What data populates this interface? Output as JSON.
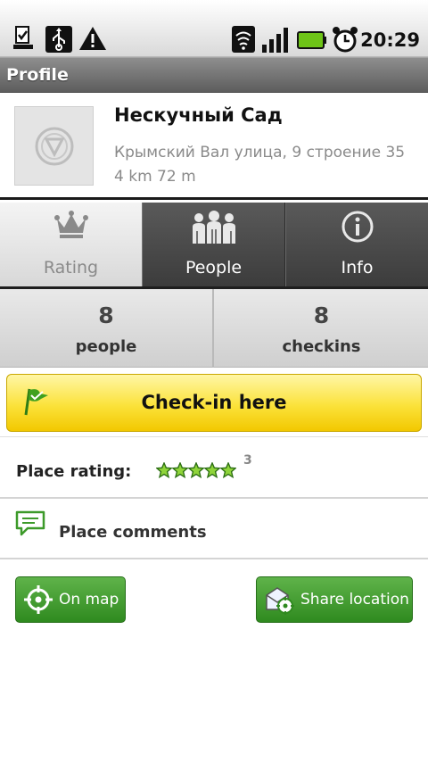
{
  "status_bar": {
    "time": "20:29",
    "icons": [
      "download-done-icon",
      "usb-icon",
      "warning-icon",
      "wifi-icon",
      "signal-icon",
      "battery-icon",
      "alarm-icon"
    ]
  },
  "titlebar": {
    "title": "Profile"
  },
  "place": {
    "name": "Нескучный Сад",
    "address": "Крымский Вал улица, 9 строение 35",
    "distance": "4 km 72 m"
  },
  "tabs": [
    {
      "label": "Rating",
      "icon": "crown-icon",
      "selected": true
    },
    {
      "label": "People",
      "icon": "people-icon",
      "selected": false
    },
    {
      "label": "Info",
      "icon": "info-icon",
      "selected": false
    }
  ],
  "stats": {
    "people": {
      "value": "8",
      "label": "people"
    },
    "checkins": {
      "value": "8",
      "label": "checkins"
    }
  },
  "checkin": {
    "label": "Check-in here",
    "icon": "flag-icon"
  },
  "rating": {
    "label": "Place rating:",
    "stars": 5,
    "count": "3"
  },
  "comments": {
    "label": "Place comments",
    "icon": "comment-icon"
  },
  "actions": {
    "map": {
      "label": "On map",
      "icon": "crosshair-icon"
    },
    "share": {
      "label": "Share location",
      "icon": "share-location-icon"
    }
  },
  "colors": {
    "accent_green": "#3d9a2a",
    "checkin_yellow": "#fbe23a",
    "title_bar": "#6e6e6e"
  }
}
